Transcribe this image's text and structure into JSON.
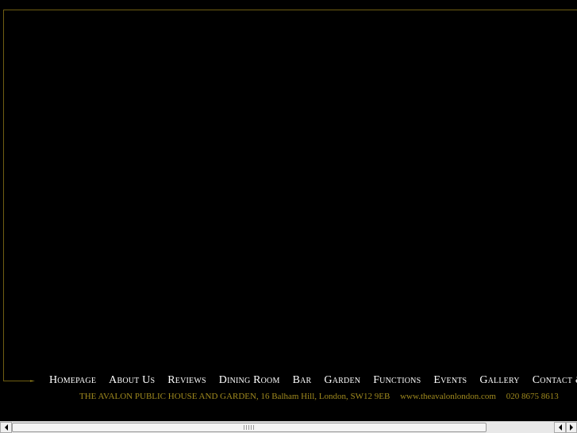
{
  "nav": {
    "items": [
      {
        "label": "Homepage"
      },
      {
        "label": "About Us"
      },
      {
        "label": "Reviews"
      },
      {
        "label": "Dining Room"
      },
      {
        "label": "Bar"
      },
      {
        "label": "Garden"
      },
      {
        "label": "Functions"
      },
      {
        "label": "Events"
      },
      {
        "label": "Gallery"
      },
      {
        "label": "Contact & Directions"
      }
    ]
  },
  "footer": {
    "address": "THE AVALON PUBLIC HOUSE AND GARDEN, 16 Balham Hill, London, SW12 9EB",
    "website": "www.theavalonlondon.com",
    "phone": "020 8675 8613"
  },
  "colors": {
    "background": "#000000",
    "frame_line": "#6f5e12",
    "nav_text": "#ffffff",
    "footer_text": "#a08a1e"
  },
  "scrollbar": {
    "left_icon": "arrow-left-icon",
    "right_icon": "arrow-right-icon",
    "grip_icon": "grip-icon"
  }
}
